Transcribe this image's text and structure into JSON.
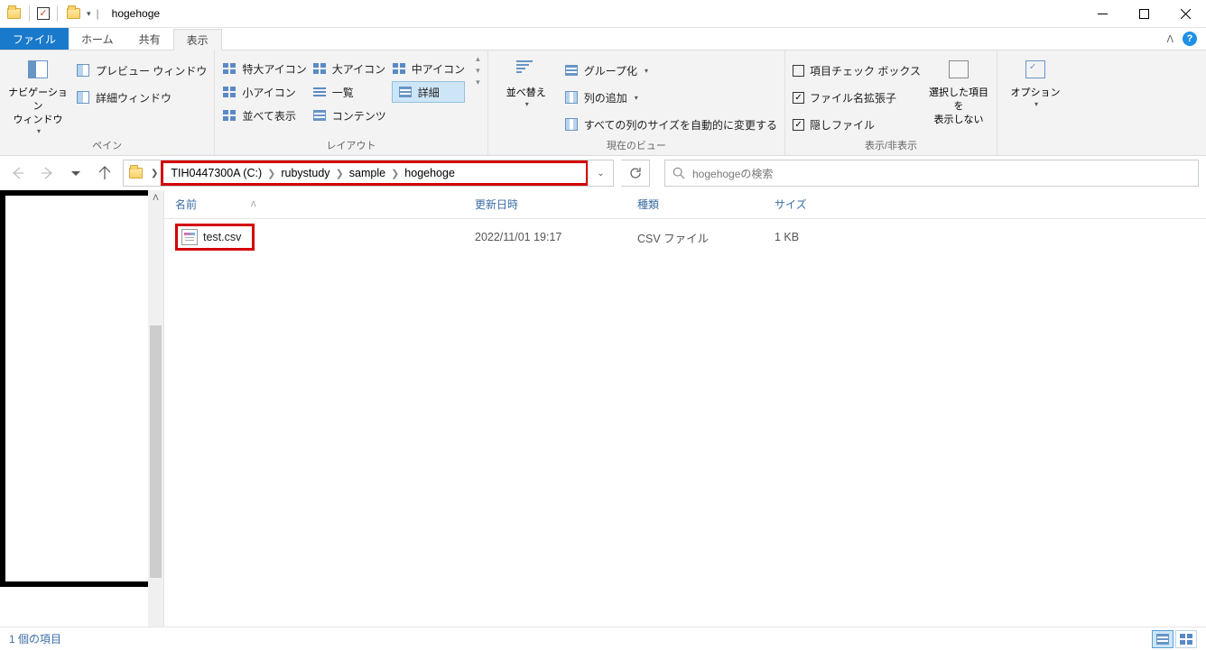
{
  "window": {
    "title": "hogehoge"
  },
  "tabs": {
    "file": "ファイル",
    "home": "ホーム",
    "share": "共有",
    "view": "表示"
  },
  "ribbon": {
    "panes_group": "ペイン",
    "layout_group": "レイアウト",
    "current_view_group": "現在のビュー",
    "show_hide_group": "表示/非表示",
    "nav_pane": "ナビゲーション\nウィンドウ",
    "preview_pane": "プレビュー ウィンドウ",
    "details_pane": "詳細ウィンドウ",
    "extra_large": "特大アイコン",
    "large": "大アイコン",
    "medium": "中アイコン",
    "small": "小アイコン",
    "list": "一覧",
    "details": "詳細",
    "tiles": "並べて表示",
    "content": "コンテンツ",
    "sort": "並べ替え",
    "group_by": "グループ化",
    "add_columns": "列の追加",
    "size_all": "すべての列のサイズを自動的に変更する",
    "item_checkboxes": "項目チェック ボックス",
    "file_ext": "ファイル名拡張子",
    "hidden": "隠しファイル",
    "hide_selected": "選択した項目を\n表示しない",
    "options": "オプション"
  },
  "breadcrumb": {
    "p0": "TIH0447300A (C:)",
    "p1": "rubystudy",
    "p2": "sample",
    "p3": "hogehoge"
  },
  "search": {
    "placeholder": "hogehogeの検索"
  },
  "columns": {
    "name": "名前",
    "date": "更新日時",
    "type": "種類",
    "size": "サイズ"
  },
  "files": {
    "f0": {
      "name": "test.csv",
      "date": "2022/11/01 19:17",
      "type": "CSV ファイル",
      "size": "1 KB"
    }
  },
  "status": {
    "count": "1 個の項目"
  }
}
